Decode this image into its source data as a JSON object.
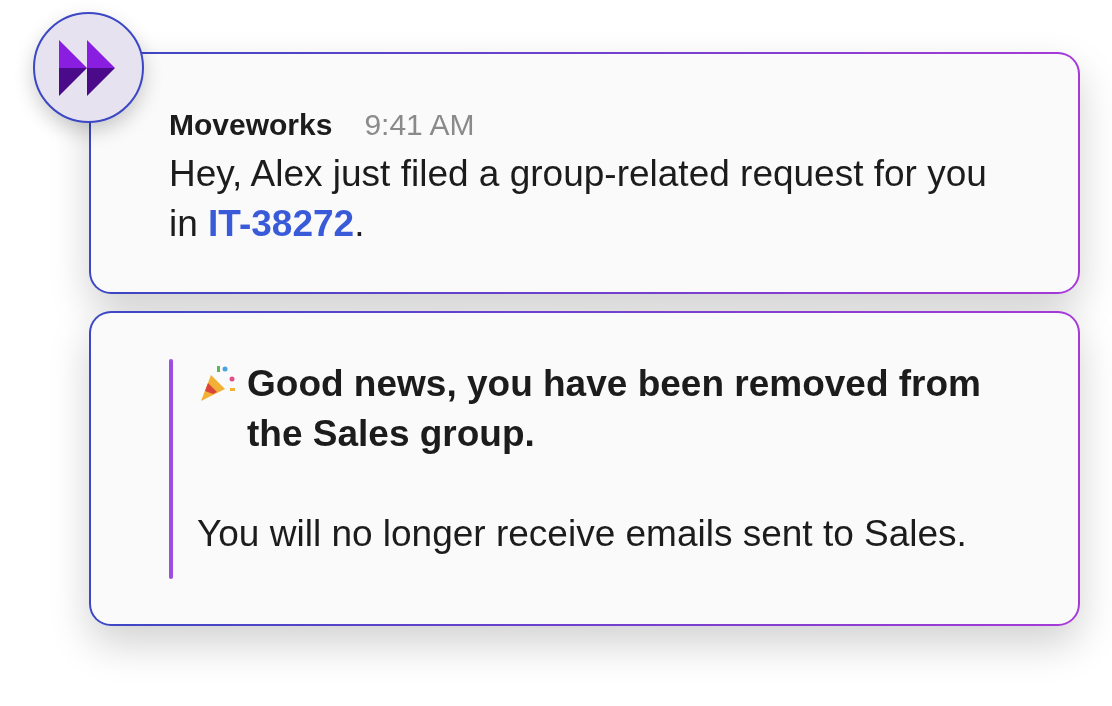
{
  "message": {
    "sender": "Moveworks",
    "time": "9:41 AM",
    "text_before": "Hey, Alex just filed a group-related request for you in ",
    "link": "IT-38272",
    "text_after": "."
  },
  "quote": {
    "headline": "Good news, you have been removed from the Sales group.",
    "body": "You will no longer receive emails sent to Sales."
  }
}
